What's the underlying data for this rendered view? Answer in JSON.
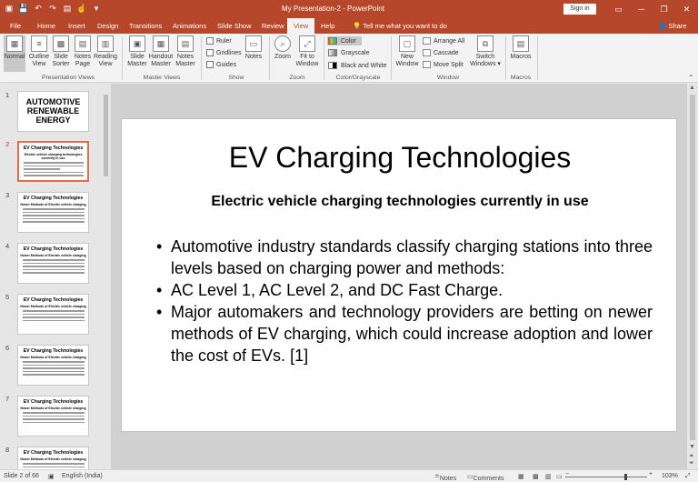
{
  "window": {
    "title": "My Presentation-2  -  PowerPoint",
    "signin_label": "Sign in"
  },
  "tabs": [
    "File",
    "Home",
    "Insert",
    "Design",
    "Transitions",
    "Animations",
    "Slide Show",
    "Review",
    "View",
    "Help"
  ],
  "active_tab": "View",
  "tell_me": "Tell me what you want to do",
  "share_label": "Share",
  "ribbon": {
    "presentation_views": {
      "title": "Presentation Views",
      "normal": "Normal",
      "outline_view": [
        "Outline",
        "View"
      ],
      "slide_sorter": [
        "Slide",
        "Sorter"
      ],
      "notes_page": [
        "Notes",
        "Page"
      ],
      "reading_view": [
        "Reading",
        "View"
      ]
    },
    "master_views": {
      "title": "Master Views",
      "slide_master": [
        "Slide",
        "Master"
      ],
      "handout_master": [
        "Handout",
        "Master"
      ],
      "notes_master": [
        "Notes",
        "Master"
      ]
    },
    "show": {
      "title": "Show",
      "ruler": "Ruler",
      "gridlines": "Gridlines",
      "guides": "Guides",
      "notes": "Notes"
    },
    "zoom": {
      "title": "Zoom",
      "zoom": "Zoom",
      "fit_to_window": [
        "Fit to",
        "Window"
      ]
    },
    "color_grayscale": {
      "title": "Color/Grayscale",
      "color": "Color",
      "grayscale": "Grayscale",
      "black_and_white": "Black and White"
    },
    "window": {
      "title": "Window",
      "new_window": [
        "New",
        "Window"
      ],
      "arrange_all": "Arrange All",
      "cascade": "Cascade",
      "move_split": "Move Split",
      "switch_windows": [
        "Switch",
        "Windows ▾"
      ]
    },
    "macros": {
      "title": "Macros",
      "macros": "Macros"
    }
  },
  "thumbnails": [
    {
      "num": "1",
      "title": "AUTOMOTIVE RENEWABLE ENERGY",
      "title_lines": [
        "AUTOMOTIVE",
        "RENEWABLE",
        "ENERGY"
      ]
    },
    {
      "num": "2",
      "title": "EV Charging Technologies",
      "sub": "Electric vehicle charging technologies currently in use"
    },
    {
      "num": "3",
      "title": "EV Charging Technologies",
      "sub": "Newer Methods of Electric vehicle charging"
    },
    {
      "num": "4",
      "title": "EV Charging Technologies",
      "sub": "Newer Methods of Electric vehicle charging"
    },
    {
      "num": "5",
      "title": "EV Charging Technologies",
      "sub": "Newer Methods of Electric vehicle charging"
    },
    {
      "num": "6",
      "title": "EV Charging Technologies",
      "sub": "Newer Methods of Electric vehicle charging"
    },
    {
      "num": "7",
      "title": "EV Charging Technologies",
      "sub": "Newer Methods of Electric vehicle charging"
    },
    {
      "num": "8",
      "title": "EV Charging Technologies",
      "sub": "Newer Methods of Electric vehicle charging"
    }
  ],
  "slide": {
    "title": "EV Charging Technologies",
    "subtitle": "Electric vehicle charging technologies currently in use",
    "bullets": [
      "Automotive industry standards classify charging stations into three levels based on charging power and methods:",
      "AC Level 1, AC Level 2, and DC Fast Charge.",
      "Major automakers and technology providers are betting on newer methods of EV charging, which could increase adoption and lower the cost of EVs. [1]"
    ]
  },
  "status": {
    "slide_counter": "Slide 2 of 66",
    "language": "English (India)",
    "notes": "Notes",
    "comments": "Comments",
    "zoom": "103%",
    "zoom_level": 0.73
  },
  "colors": {
    "accent": "#b7472a",
    "active_thumb_border": "#e46c4a"
  }
}
